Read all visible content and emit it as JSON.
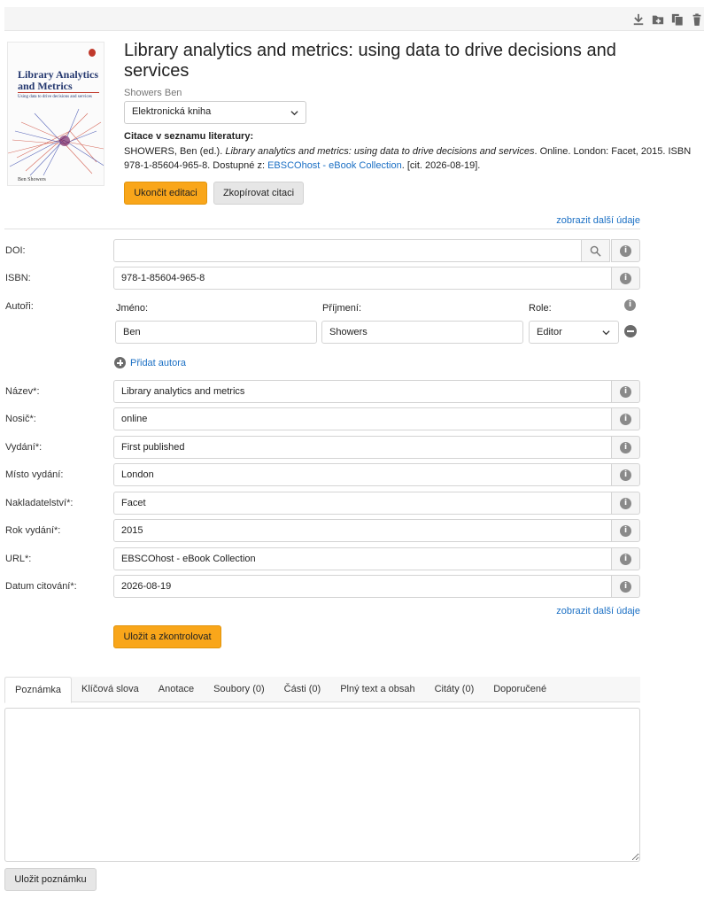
{
  "toolbar": {
    "icons": [
      "download-icon",
      "folder-add-icon",
      "copy-icon",
      "trash-icon"
    ]
  },
  "cover": {
    "title": "Library Analytics and Metrics",
    "subtitle": "Using data to drive decisions and services",
    "author": "Ben Showers"
  },
  "record": {
    "title": "Library analytics and metrics: using data to drive decisions and services",
    "author": "Showers Ben",
    "type_selected": "Elektronická kniha",
    "citation_label": "Citace v seznamu literatury:",
    "citation_prefix": "SHOWERS, Ben (ed.).",
    "citation_title": "Library analytics and metrics: using data to drive decisions and services",
    "citation_mid": ". Online. London: Facet, 2015. ISBN 978-1-85604-965-8. Dostupné z:",
    "citation_link": "EBSCOhost - eBook Collection",
    "citation_suffix": ". [cit. 2026-08-19].",
    "end_edit_label": "Ukončit editaci",
    "copy_citation_label": "Zkopírovat citaci",
    "more_details_label": "zobrazit další údaje"
  },
  "form": {
    "doi_label": "DOI:",
    "doi_value": "",
    "isbn_label": "ISBN:",
    "isbn_value": "978-1-85604-965-8",
    "authors_label": "Autoři:",
    "first_name_header": "Jméno:",
    "last_name_header": "Příjmení:",
    "role_header": "Role:",
    "author_first": "Ben",
    "author_last": "Showers",
    "author_role": "Editor",
    "add_author_label": "Přidat autora",
    "fields": [
      {
        "label": "Název*:",
        "value": "Library analytics and metrics"
      },
      {
        "label": "Nosič*:",
        "value": "online"
      },
      {
        "label": "Vydání*:",
        "value": "First published"
      },
      {
        "label": "Místo vydání:",
        "value": "London"
      },
      {
        "label": "Nakladatelství*:",
        "value": "Facet"
      },
      {
        "label": "Rok vydání*:",
        "value": "2015"
      },
      {
        "label": "URL*:",
        "value": "EBSCOhost - eBook Collection"
      },
      {
        "label": "Datum citování*:",
        "value": "2026-08-19"
      }
    ],
    "more_details_label": "zobrazit další údaje",
    "save_label": "Uložit a zkontrolovat"
  },
  "tabs": [
    "Poznámka",
    "Klíčová slova",
    "Anotace",
    "Soubory (0)",
    "Části (0)",
    "Plný text a obsah",
    "Citáty (0)",
    "Doporučené"
  ],
  "note": {
    "value": "",
    "save_label": "Uložit poznámku"
  },
  "colors": {
    "accent_orange": "#f9a61a",
    "link_blue": "#1a6fc4"
  }
}
